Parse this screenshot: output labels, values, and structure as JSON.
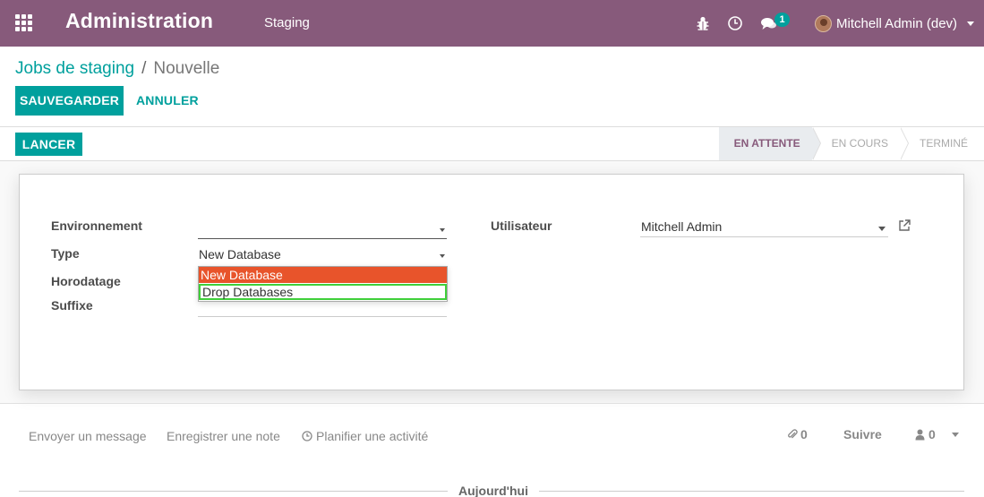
{
  "navbar": {
    "app_title": "Administration",
    "menu_item": "Staging",
    "bg_color": "#875a7b",
    "icons": [
      "apps-icon",
      "bug-icon",
      "clock-icon",
      "chat-icon"
    ],
    "chat_badge": "1",
    "user_name": "Mitchell Admin (dev)"
  },
  "breadcrumb": {
    "parent": "Jobs de staging",
    "separator": "/",
    "current": "Nouvelle"
  },
  "buttons": {
    "save": "SAUVEGARDER",
    "cancel": "ANNULER",
    "launch": "LANCER"
  },
  "statusbar": {
    "stages": [
      {
        "label": "EN ATTENTE",
        "active": true
      },
      {
        "label": "EN COURS",
        "active": false
      },
      {
        "label": "TERMINÉ",
        "active": false
      }
    ]
  },
  "form": {
    "environment": {
      "label": "Environnement",
      "value": ""
    },
    "type": {
      "label": "Type",
      "value": "New Database"
    },
    "timestamp": {
      "label": "Horodatage",
      "value": ""
    },
    "suffix": {
      "label": "Suffixe",
      "value": ""
    },
    "user": {
      "label": "Utilisateur",
      "value": "Mitchell Admin"
    },
    "type_options": [
      "New Database",
      "Drop Databases"
    ],
    "accent_color": "#00a09d"
  },
  "chatter": {
    "send_message": "Envoyer un message",
    "log_note": "Enregistrer une note",
    "schedule_activity": "Planifier une activité",
    "attachments_count": "0",
    "follow": "Suivre",
    "followers_count": "0",
    "date_separator": "Aujourd'hui"
  }
}
